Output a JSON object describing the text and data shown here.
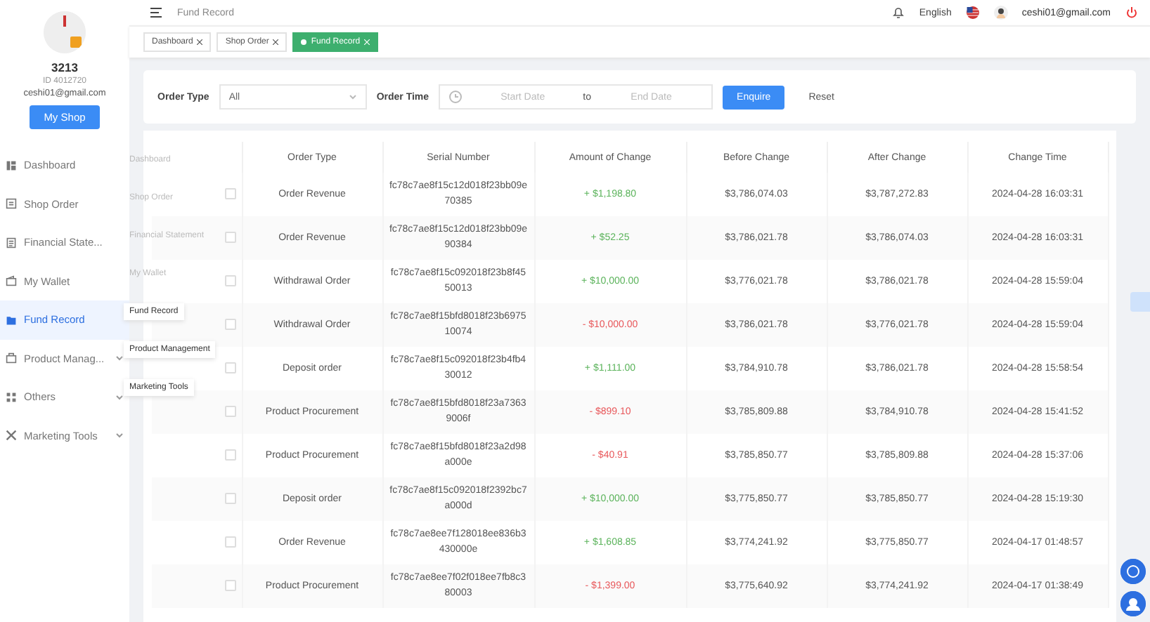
{
  "profile": {
    "name": "3213",
    "id": "ID 4012720",
    "email": "ceshi01@gmail.com",
    "button": "My Shop"
  },
  "sidebar": {
    "items": [
      {
        "label": "Dashboard",
        "selected": false,
        "expandable": false
      },
      {
        "label": "Shop Order",
        "selected": false,
        "expandable": false
      },
      {
        "label": "Financial State...",
        "selected": false,
        "expandable": false
      },
      {
        "label": "My Wallet",
        "selected": false,
        "expandable": false
      },
      {
        "label": "Fund Record",
        "selected": true,
        "expandable": false
      },
      {
        "label": "Product Manag...",
        "selected": false,
        "expandable": true
      },
      {
        "label": "Others",
        "selected": false,
        "expandable": true
      },
      {
        "label": "Marketing Tools",
        "selected": false,
        "expandable": true
      }
    ]
  },
  "header": {
    "title": "Fund Record",
    "language": "English",
    "user": "ceshi01@gmail.com"
  },
  "tags": [
    {
      "label": "Dashboard",
      "selected": false
    },
    {
      "label": "Shop Order",
      "selected": false
    },
    {
      "label": "Fund Record",
      "selected": true
    }
  ],
  "filters": {
    "order_type_label": "Order Type",
    "order_type_value": "All",
    "time_label": "Order Time",
    "start_placeholder": "Start Date",
    "separator": "to",
    "end_placeholder": "End Date",
    "buttons": [
      {
        "label": "Enquire",
        "kind": "primary"
      },
      {
        "label": "Reset",
        "kind": "plain"
      }
    ]
  },
  "table": {
    "columns": [
      "Order Type",
      "Serial Number",
      "Amount of Change",
      "Before Change",
      "After Change",
      "Change Time"
    ],
    "rows": [
      {
        "checked": false,
        "type": "Order Revenue",
        "serial": "fc78c7ae8f15c12d018f23bb09e70385",
        "amount": "+ $1,198.80",
        "kind": "credit",
        "before": "$3,786,074.03",
        "after": "$3,787,272.83",
        "time": "2024-04-28 16:03:31"
      },
      {
        "checked": false,
        "type": "Order Revenue",
        "serial": "fc78c7ae8f15c12d018f23bb09e90384",
        "amount": "+ $52.25",
        "kind": "credit",
        "before": "$3,786,021.78",
        "after": "$3,786,074.03",
        "time": "2024-04-28 16:03:31"
      },
      {
        "checked": false,
        "type": "Withdrawal Order",
        "serial": "fc78c7ae8f15c092018f23b8f4550013",
        "amount": "+ $10,000.00",
        "kind": "credit",
        "before": "$3,776,021.78",
        "after": "$3,786,021.78",
        "time": "2024-04-28 15:59:04"
      },
      {
        "checked": false,
        "type": "Withdrawal Order",
        "serial": "fc78c7ae8f15bfd8018f23b697510074",
        "amount": "- $10,000.00",
        "kind": "debit",
        "before": "$3,786,021.78",
        "after": "$3,776,021.78",
        "time": "2024-04-28 15:59:04"
      },
      {
        "checked": false,
        "type": "Deposit order",
        "serial": "fc78c7ae8f15c092018f23b4fb430012",
        "amount": "+ $1,111.00",
        "kind": "credit",
        "before": "$3,784,910.78",
        "after": "$3,786,021.78",
        "time": "2024-04-28 15:58:54"
      },
      {
        "checked": false,
        "type": "Product Procurement",
        "serial": "fc78c7ae8f15bfd8018f23a73639006f",
        "amount": "- $899.10",
        "kind": "debit",
        "before": "$3,785,809.88",
        "after": "$3,784,910.78",
        "time": "2024-04-28 15:41:52"
      },
      {
        "checked": false,
        "type": "Product Procurement",
        "serial": "fc78c7ae8f15bfd8018f23a2d98a000e",
        "amount": "- $40.91",
        "kind": "debit",
        "before": "$3,785,850.77",
        "after": "$3,785,809.88",
        "time": "2024-04-28 15:37:06"
      },
      {
        "checked": false,
        "type": "Deposit order",
        "serial": "fc78c7ae8f15c092018f2392bc7a000d",
        "amount": "+ $10,000.00",
        "kind": "credit",
        "before": "$3,775,850.77",
        "after": "$3,785,850.77",
        "time": "2024-04-28 15:19:30"
      },
      {
        "checked": false,
        "type": "Order Revenue",
        "serial": "fc78c7ae8ee7f128018ee836b3430000e",
        "amount": "+ $1,608.85",
        "kind": "credit",
        "before": "$3,774,241.92",
        "after": "$3,775,850.77",
        "time": "2024-04-17 01:48:57"
      },
      {
        "checked": false,
        "type": "Product Procurement",
        "serial": "fc78c7ae8ee7f02f018ee7fb8c380003",
        "amount": "- $1,399.00",
        "kind": "debit",
        "before": "$3,775,640.92",
        "after": "$3,774,241.92",
        "time": "2024-04-17 01:38:49"
      }
    ]
  },
  "tooltips": [
    {
      "label": "Dashboard",
      "faded": true
    },
    {
      "label": "Shop Order",
      "faded": true
    },
    {
      "label": "Financial Statement",
      "faded": true
    },
    {
      "label": "My Wallet",
      "faded": true
    },
    {
      "label": "Fund Record",
      "faded": false
    },
    {
      "label": "Product Management",
      "faded": false
    },
    {
      "label": "Marketing Tools",
      "faded": false
    }
  ]
}
